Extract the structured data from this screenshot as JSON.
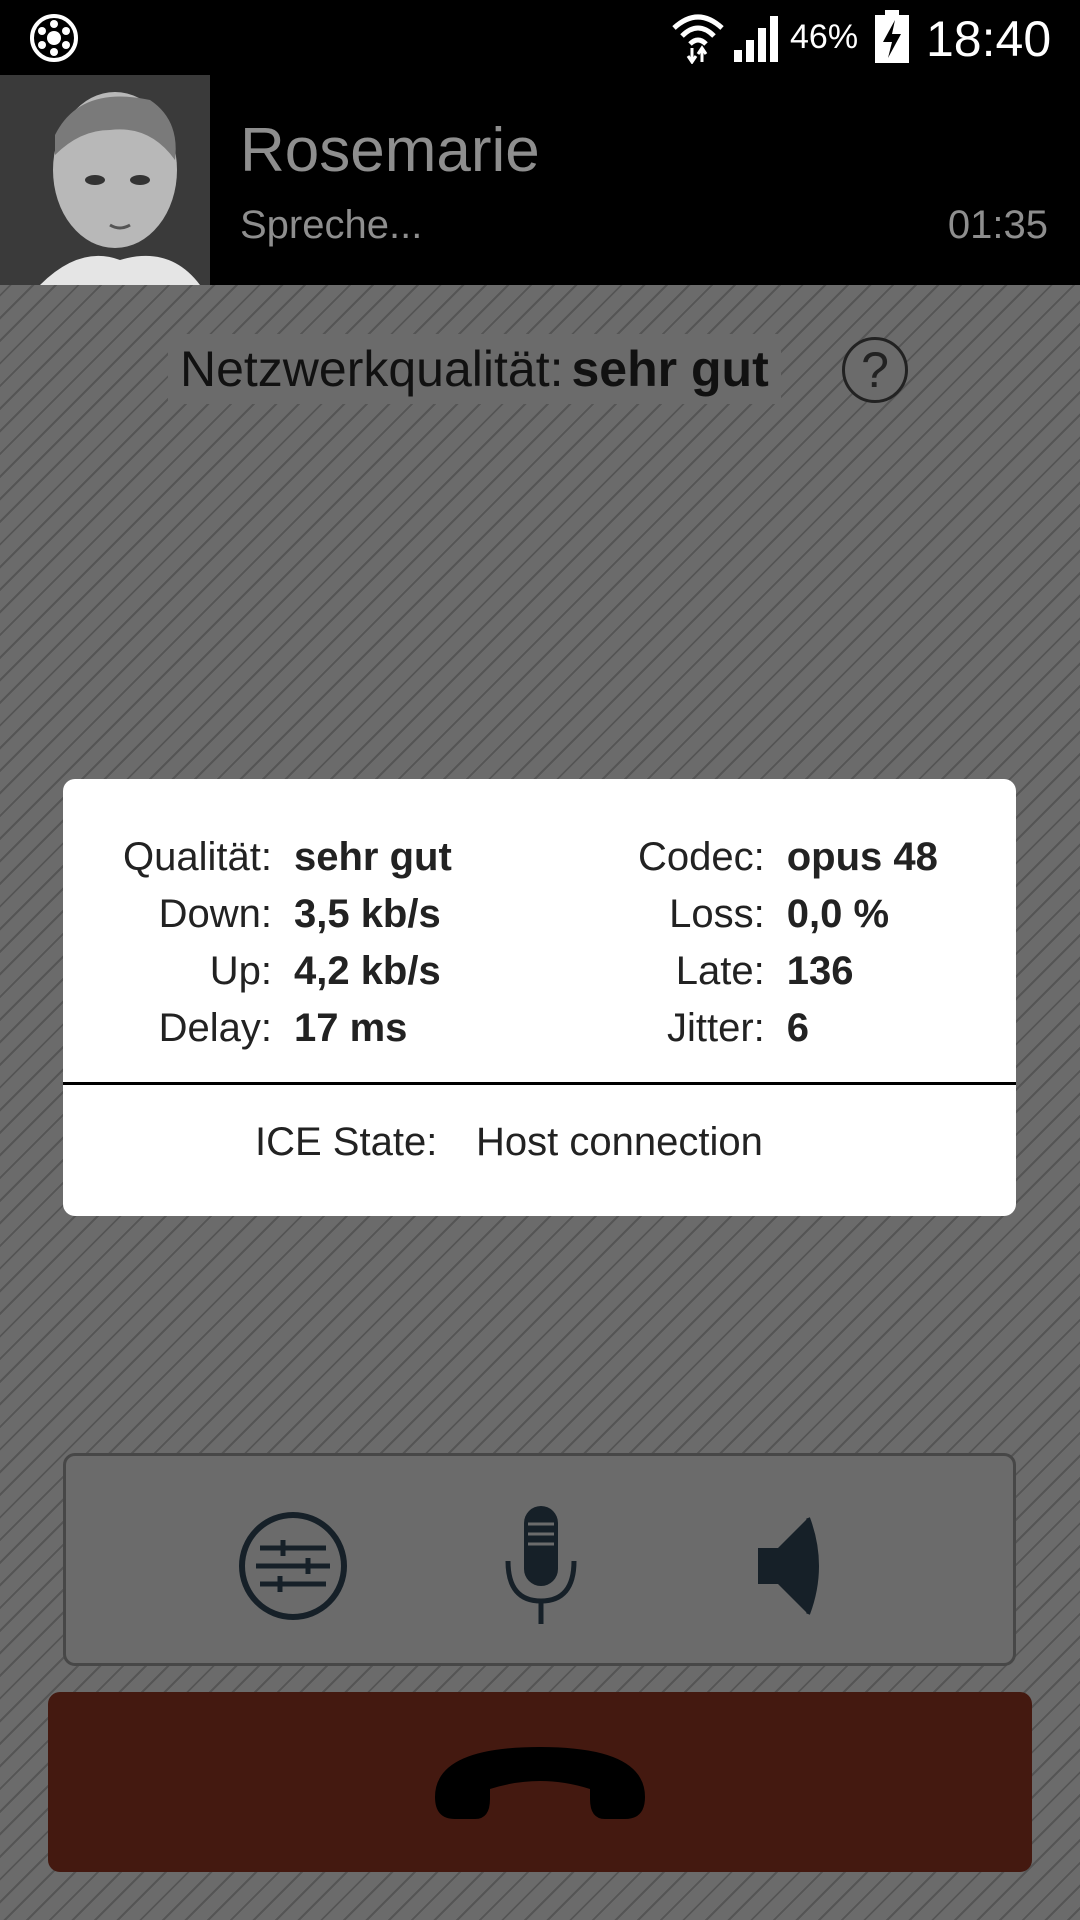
{
  "status_bar": {
    "app_icon": "rotary-phone-icon",
    "battery_percent": "46%",
    "time": "18:40"
  },
  "call": {
    "caller_name": "Rosemarie",
    "status": "Spreche...",
    "duration": "01:35"
  },
  "network_quality": {
    "label": "Netzwerkqualität:",
    "value": "sehr gut",
    "help": "?"
  },
  "stats": {
    "left": [
      {
        "label": "Qualität:",
        "value": "sehr gut"
      },
      {
        "label": "Down:",
        "value": "3,5 kb/s"
      },
      {
        "label": "Up:",
        "value": "4,2 kb/s"
      },
      {
        "label": "Delay:",
        "value": "17 ms"
      }
    ],
    "right": [
      {
        "label": "Codec:",
        "value": "opus 48"
      },
      {
        "label": "Loss:",
        "value": "0,0 %"
      },
      {
        "label": "Late:",
        "value": "136"
      },
      {
        "label": "Jitter:",
        "value": "6"
      }
    ],
    "ice_label": "ICE State:",
    "ice_value": "Host connection"
  },
  "controls": {
    "icons": [
      "equalizer-icon",
      "microphone-icon",
      "speaker-icon"
    ]
  },
  "hangup": {
    "icon": "hang-up-icon",
    "color": "#441910"
  }
}
